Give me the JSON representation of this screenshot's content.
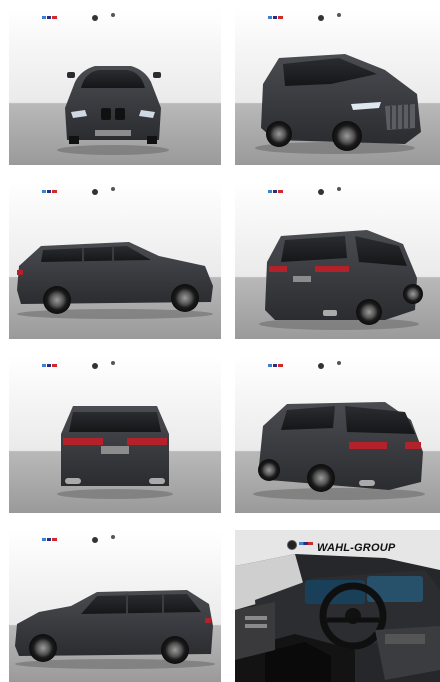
{
  "gallery": {
    "tiles": [
      {
        "view": "front",
        "alt": ""
      },
      {
        "view": "front-three-quarter",
        "alt": ""
      },
      {
        "view": "side-left",
        "alt": ""
      },
      {
        "view": "rear-three-quarter-left",
        "alt": ""
      },
      {
        "view": "rear",
        "alt": ""
      },
      {
        "view": "rear-three-quarter-right",
        "alt": ""
      },
      {
        "view": "side-left-2",
        "alt": ""
      },
      {
        "view": "interior",
        "alt": ""
      }
    ],
    "dealer_banner": "WAHL-GROUP"
  },
  "colors": {
    "car_body": "#3a3c40",
    "wall": "#f4f4f4",
    "floor": "#a9a9a9",
    "tail_light": "#b3212a"
  }
}
